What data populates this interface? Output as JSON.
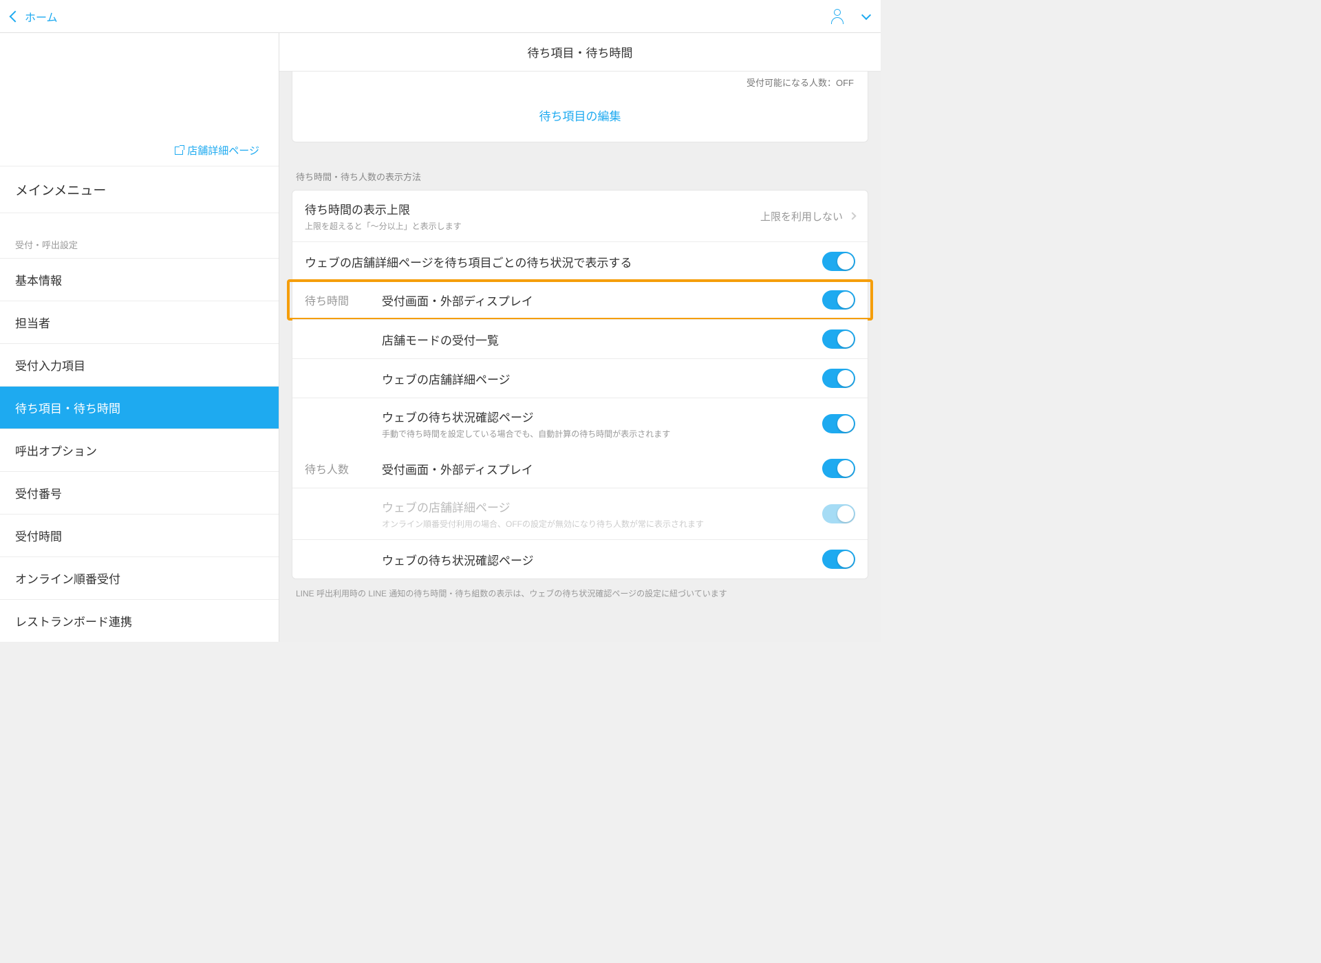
{
  "header": {
    "back_label": "ホーム"
  },
  "sidebar": {
    "store_link": "店舗詳細ページ",
    "main_menu": "メインメニュー",
    "section_label": "受付・呼出設定",
    "items": [
      "基本情報",
      "担当者",
      "受付入力項目",
      "待ち項目・待ち時間",
      "呼出オプション",
      "受付番号",
      "受付時間",
      "オンライン順番受付",
      "レストランボード連携"
    ],
    "active_index": 3
  },
  "main": {
    "title": "待ち項目・待ち時間",
    "top_card": {
      "status": "受付可能になる人数：OFF",
      "link": "待ち項目の編集"
    },
    "section_label": "待ち時間・待ち人数の表示方法",
    "limit_row": {
      "title": "待ち時間の表示上限",
      "sub": "上限を超えると「〜分以上」と表示します",
      "value": "上限を利用しない"
    },
    "web_detail_toggle": {
      "title": "ウェブの店舗詳細ページを待ち項目ごとの待ち状況で表示する"
    },
    "group1_label": "待ち時間",
    "group1": [
      {
        "title": "受付画面・外部ディスプレイ",
        "sub": "",
        "dim": false,
        "highlight": true
      },
      {
        "title": "店舗モードの受付一覧",
        "sub": "",
        "dim": false
      },
      {
        "title": "ウェブの店舗詳細ページ",
        "sub": "",
        "dim": false
      },
      {
        "title": "ウェブの待ち状況確認ページ",
        "sub": "手動で待ち時間を設定している場合でも、自動計算の待ち時間が表示されます",
        "dim": false
      }
    ],
    "group2_label": "待ち人数",
    "group2": [
      {
        "title": "受付画面・外部ディスプレイ",
        "sub": "",
        "dim": false
      },
      {
        "title": "ウェブの店舗詳細ページ",
        "sub": "オンライン順番受付利用の場合、OFFの設定が無効になり待ち人数が常に表示されます",
        "dim": true
      },
      {
        "title": "ウェブの待ち状況確認ページ",
        "sub": "",
        "dim": false
      }
    ],
    "footer_note": "LINE 呼出利用時の LINE 通知の待ち時間・待ち組数の表示は、ウェブの待ち状況確認ページの設定に紐づいています"
  }
}
